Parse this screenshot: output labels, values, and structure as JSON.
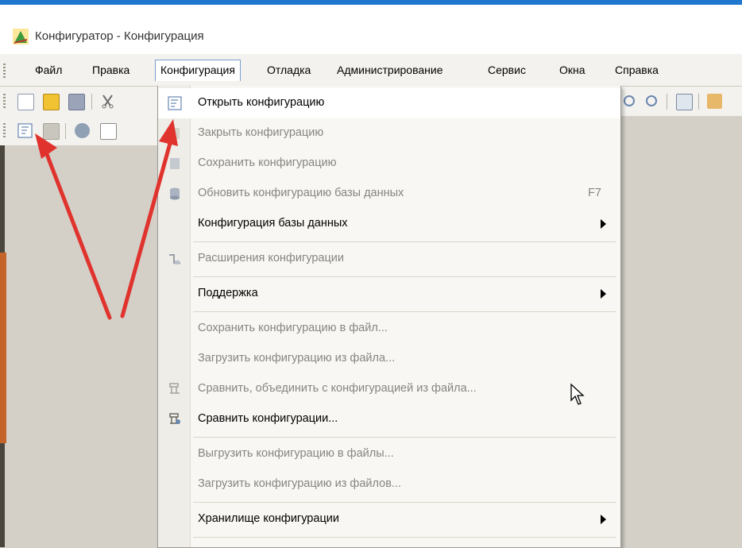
{
  "window": {
    "title": "Конфигуратор - Конфигурация"
  },
  "menubar": {
    "items": [
      {
        "label": "Файл"
      },
      {
        "label": "Правка"
      },
      {
        "label": "Конфигурация"
      },
      {
        "label": "Отладка"
      },
      {
        "label": "Администрирование"
      },
      {
        "label": "Сервис"
      },
      {
        "label": "Окна"
      },
      {
        "label": "Справка"
      }
    ]
  },
  "dropdown": {
    "items": [
      {
        "label": "Открыть конфигурацию",
        "enabled": true,
        "icon": "open-config-icon"
      },
      {
        "label": "Закрыть конфигурацию",
        "enabled": false,
        "icon": "close-config-icon"
      },
      {
        "label": "Сохранить конфигурацию",
        "enabled": false,
        "icon": "save-config-icon"
      },
      {
        "label": "Обновить конфигурацию базы данных",
        "enabled": false,
        "shortcut": "F7",
        "icon": "update-db-icon"
      },
      {
        "label": "Конфигурация базы данных",
        "enabled": true,
        "submenu": true
      },
      {
        "label": "Расширения конфигурации",
        "enabled": false,
        "icon": "extensions-icon"
      },
      {
        "label": "Поддержка",
        "enabled": true,
        "submenu": true
      },
      {
        "label": "Сохранить конфигурацию в файл...",
        "enabled": false
      },
      {
        "label": "Загрузить конфигурацию из файла...",
        "enabled": false
      },
      {
        "label": "Сравнить, объединить с конфигурацией из файла...",
        "enabled": false,
        "icon": "compare-merge-icon"
      },
      {
        "label": "Сравнить конфигурации...",
        "enabled": true,
        "icon": "compare-icon"
      },
      {
        "label": "Выгрузить конфигурацию в файлы...",
        "enabled": false
      },
      {
        "label": "Загрузить конфигурацию из файлов...",
        "enabled": false
      },
      {
        "label": "Хранилище конфигурации",
        "enabled": true,
        "submenu": true
      }
    ]
  },
  "colors": {
    "annotation_arrow": "#e0332e",
    "menu_highlight_border": "#7a9fcf",
    "disabled_text": "#888580"
  }
}
